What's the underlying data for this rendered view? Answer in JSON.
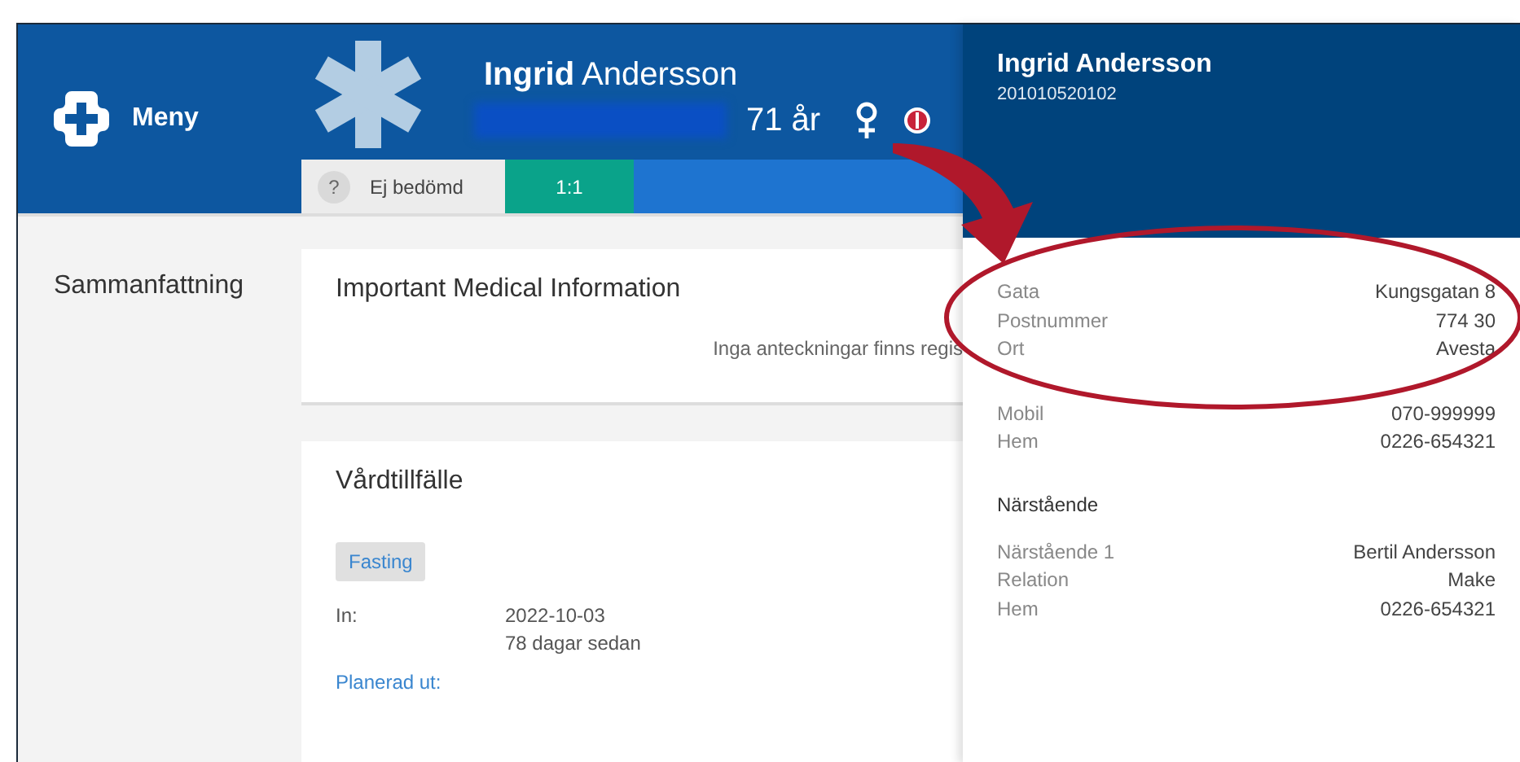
{
  "menu": {
    "label": "Meny"
  },
  "patient": {
    "name": "**Ingrid** Andersson",
    "age": "71 år"
  },
  "status_tabs": [
    {
      "kind": "triage",
      "icon": "?",
      "label": "Ej bedömd"
    },
    {
      "kind": "ratio",
      "label": "1:1"
    }
  ],
  "sidebar": {
    "title": "Sammanfattning"
  },
  "important_info": {
    "title": "Important Medical Information",
    "empty_text": "Inga anteckningar finns regis"
  },
  "care_episode": {
    "title": "Vårdtillfälle",
    "tag": "Fasting",
    "fields": [
      {
        "label": "In:",
        "lines": [
          "2022-10-03",
          "78 dagar sedan"
        ]
      }
    ],
    "link": "Planerad ut:"
  },
  "panel": {
    "name": "Ingrid Andersson",
    "id_number": "201010520102",
    "sections": [
      {
        "rows": [
          {
            "label": "Gata",
            "value": "Kungsgatan 8"
          },
          {
            "label": "Postnummer",
            "value": "774 30"
          },
          {
            "label": "Ort",
            "value": "Avesta"
          }
        ]
      },
      {
        "rows": [
          {
            "label": "Mobil",
            "value": "070-999999"
          },
          {
            "label": "Hem",
            "value": "0226-654321"
          }
        ]
      },
      {
        "heading": "Närstående",
        "rows": [
          {
            "label": "Närstående 1",
            "value": "Bertil Andersson"
          },
          {
            "label": "Relation",
            "value": "Make"
          },
          {
            "label": "Hem",
            "value": "0226-654321"
          }
        ]
      }
    ]
  }
}
